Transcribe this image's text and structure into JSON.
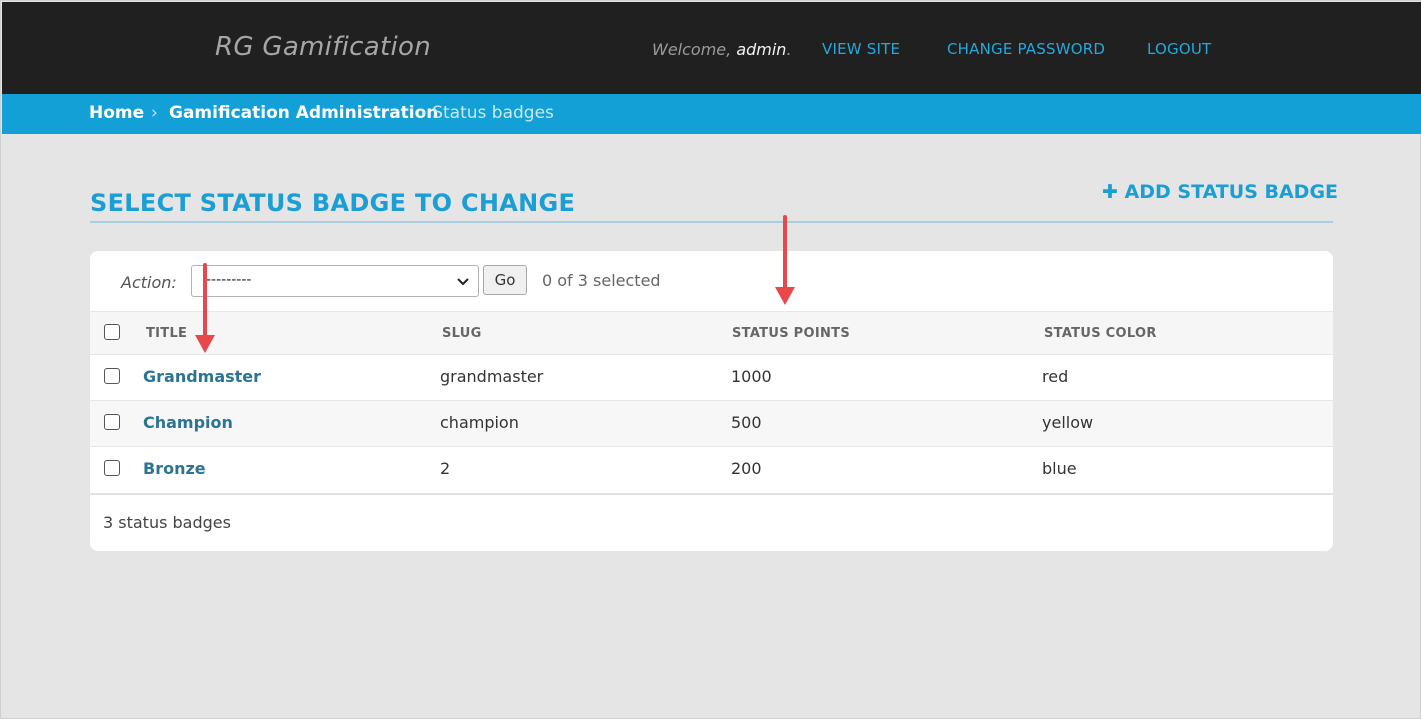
{
  "header": {
    "brand": "RG Gamification",
    "welcome_prefix": "Welcome,",
    "username": "admin",
    "welcome_suffix": ".",
    "links": [
      "VIEW SITE",
      "CHANGE PASSWORD",
      "LOGOUT"
    ]
  },
  "breadcrumbs": {
    "home": "Home",
    "sep": "›",
    "app": "Gamification Administration",
    "current": "› Status badges"
  },
  "page": {
    "title": "SELECT STATUS BADGE TO CHANGE",
    "add_button": "ADD STATUS BADGE",
    "add_icon": "plus-icon"
  },
  "actions": {
    "label": "Action:",
    "selected_value": "---------",
    "go_label": "Go",
    "selected_count": "0 of 3 selected"
  },
  "table": {
    "headers": [
      "TITLE",
      "SLUG",
      "STATUS POINTS",
      "STATUS COLOR"
    ],
    "rows": [
      {
        "title": "Grandmaster",
        "slug": "grandmaster",
        "points": "1000",
        "color": "red"
      },
      {
        "title": "Champion",
        "slug": "champion",
        "points": "500",
        "color": "yellow"
      },
      {
        "title": "Bronze",
        "slug": "2",
        "points": "200",
        "color": "blue"
      }
    ]
  },
  "paginator": "3 status badges",
  "colors": {
    "header_bg": "#202020",
    "breadcrumb_bg": "#12a0d6",
    "accent": "#1b9ed4",
    "link": "#2d7494",
    "annotation_arrow": "#e8474b"
  }
}
